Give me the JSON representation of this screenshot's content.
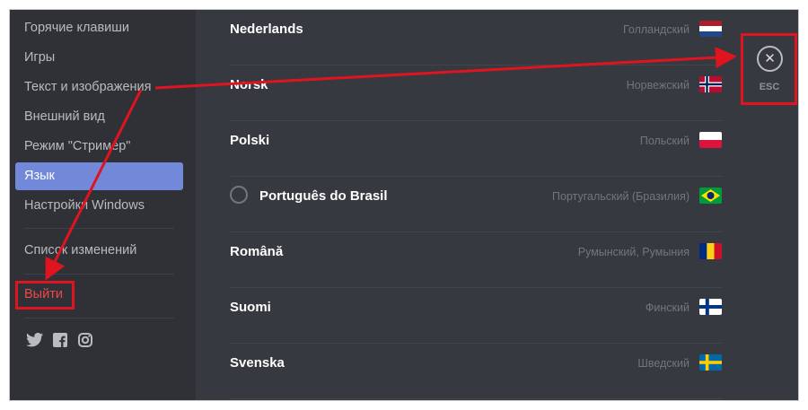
{
  "sidebar": {
    "items": [
      {
        "label": "Горячие клавиши"
      },
      {
        "label": "Игры"
      },
      {
        "label": "Текст и изображения"
      },
      {
        "label": "Внешний вид"
      },
      {
        "label": "Режим \"Стример\""
      },
      {
        "label": "Язык",
        "active": true
      },
      {
        "label": "Настройки Windows"
      }
    ],
    "changelog_label": "Список изменений",
    "logout_label": "Выйти",
    "social_icons": [
      "twitter-icon",
      "facebook-icon",
      "instagram-icon"
    ]
  },
  "languages": [
    {
      "name": "Nederlands",
      "native": "Голландский",
      "flag": "netherlands"
    },
    {
      "name": "Norsk",
      "native": "Норвежский",
      "flag": "norway"
    },
    {
      "name": "Polski",
      "native": "Польский",
      "flag": "poland"
    },
    {
      "name": "Português do Brasil",
      "native": "Португальский (Бразилия)",
      "flag": "brazil",
      "selected": false
    },
    {
      "name": "Română",
      "native": "Румынский, Румыния",
      "flag": "romania"
    },
    {
      "name": "Suomi",
      "native": "Финский",
      "flag": "finland"
    },
    {
      "name": "Svenska",
      "native": "Шведский",
      "flag": "sweden"
    }
  ],
  "close": {
    "label": "ESC",
    "icon": "close-icon"
  },
  "colors": {
    "accent": "#7289da",
    "logout": "#f04747",
    "annotation": "#e0141e",
    "sidebar_bg": "#2f3136",
    "content_bg": "#36393f"
  }
}
